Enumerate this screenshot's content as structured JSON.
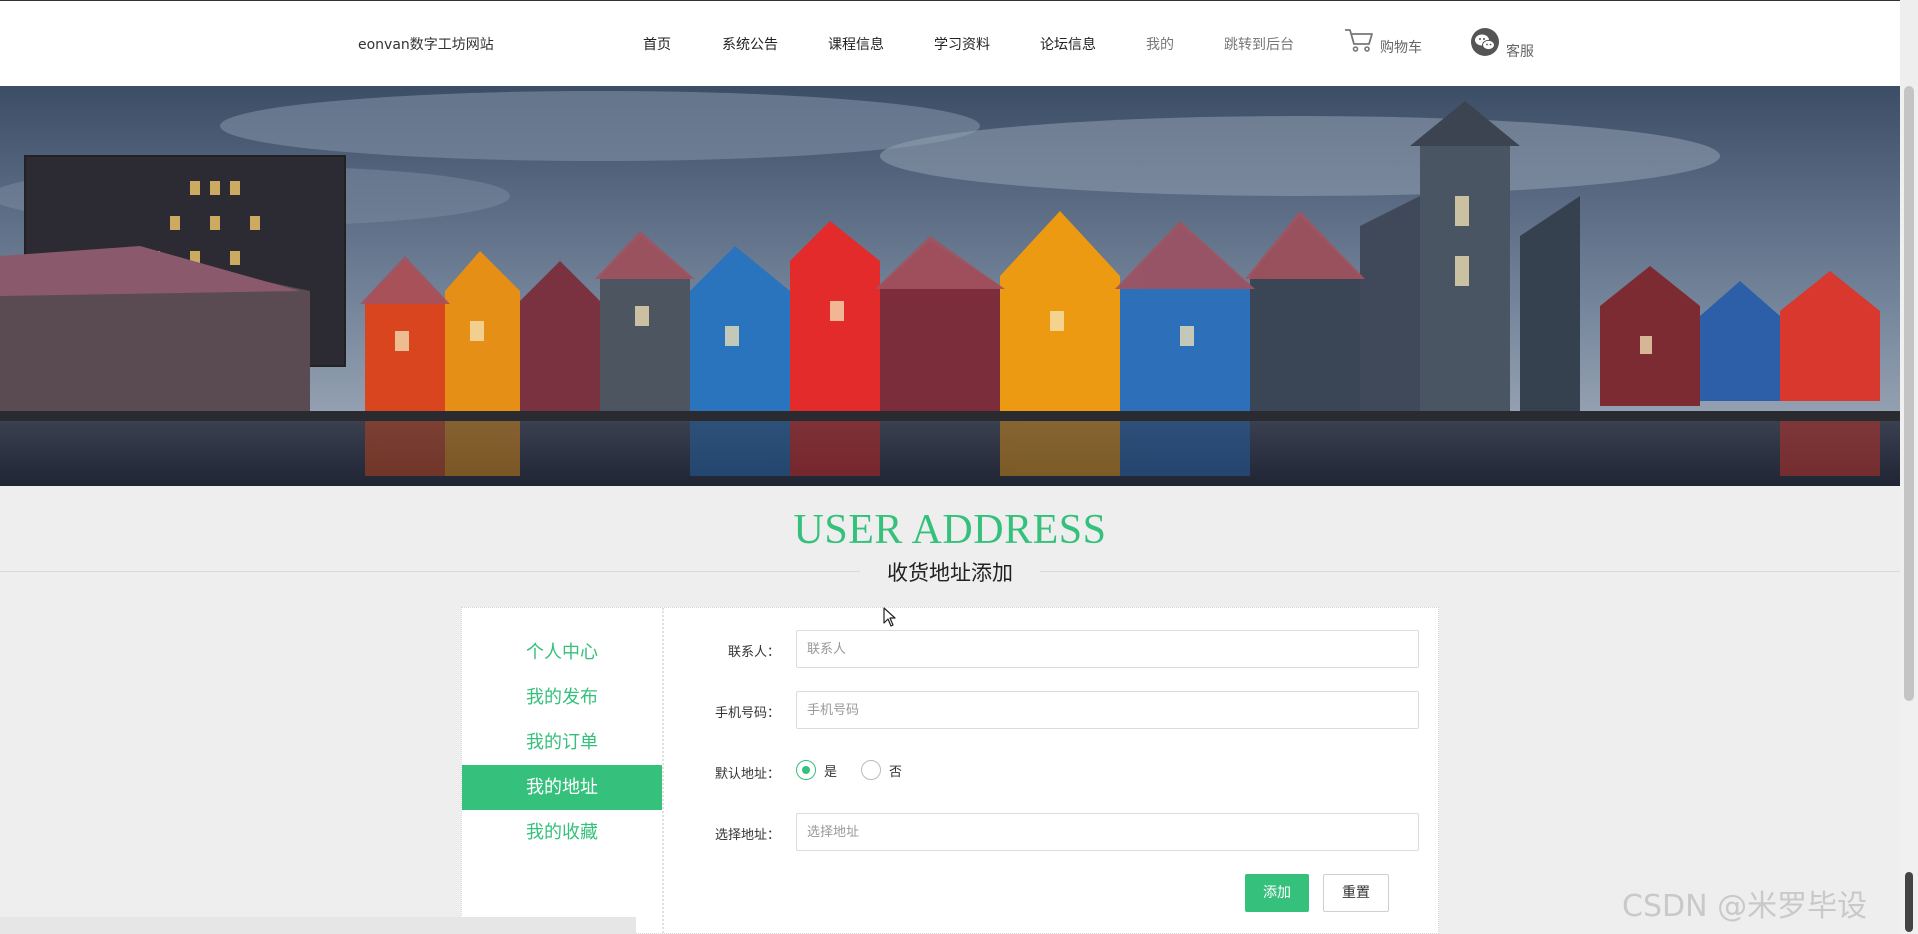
{
  "header": {
    "logo": "eonvan数字工坊网站",
    "nav": [
      {
        "label": "首页",
        "name": "nav-home"
      },
      {
        "label": "系统公告",
        "name": "nav-announcements"
      },
      {
        "label": "课程信息",
        "name": "nav-courses"
      },
      {
        "label": "学习资料",
        "name": "nav-materials"
      },
      {
        "label": "论坛信息",
        "name": "nav-forum"
      },
      {
        "label": "我的",
        "name": "nav-mine"
      },
      {
        "label": "跳转到后台",
        "name": "nav-admin"
      }
    ],
    "cart_label": "购物车",
    "service_label": "客服",
    "cart_icon": "cart-icon",
    "service_icon": "wechat-icon"
  },
  "banner": {
    "subject": "colorful waterfront houses at dusk"
  },
  "title": {
    "en": "USER ADDRESS",
    "cn": "收货地址添加"
  },
  "sidebar": {
    "items": [
      {
        "label": "个人中心",
        "active": false
      },
      {
        "label": "我的发布",
        "active": false
      },
      {
        "label": "我的订单",
        "active": false
      },
      {
        "label": "我的地址",
        "active": true
      },
      {
        "label": "我的收藏",
        "active": false
      }
    ]
  },
  "form": {
    "contact": {
      "label": "联系人：",
      "placeholder": "联系人",
      "value": ""
    },
    "phone": {
      "label": "手机号码：",
      "placeholder": "手机号码",
      "value": ""
    },
    "default": {
      "label": "默认地址：",
      "yes": "是",
      "no": "否",
      "selected": "是"
    },
    "address": {
      "label": "选择地址：",
      "placeholder": "选择地址",
      "value": ""
    },
    "add_button": "添加",
    "reset_button": "重置"
  },
  "watermark": "CSDN @米罗毕设",
  "colors": {
    "accent": "#35c07c",
    "background": "#eeeeee"
  }
}
